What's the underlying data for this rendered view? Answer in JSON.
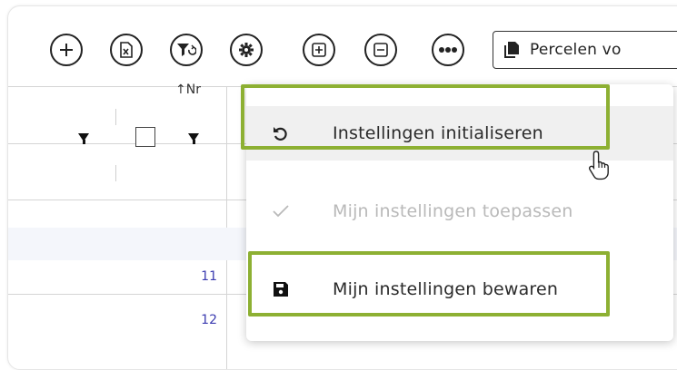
{
  "toolbar": {
    "buttons": [
      {
        "name": "add-button",
        "icon": "plus-icon"
      },
      {
        "name": "export-excel-button",
        "icon": "excel-icon"
      },
      {
        "name": "reset-filter-button",
        "icon": "filter-reset-icon"
      },
      {
        "name": "settings-button",
        "icon": "gear-icon"
      },
      {
        "name": "expand-all-button",
        "icon": "plus-square-icon"
      },
      {
        "name": "collapse-all-button",
        "icon": "minus-square-icon"
      },
      {
        "name": "more-button",
        "icon": "ellipsis-icon"
      }
    ],
    "percelen_label": "Percelen vo"
  },
  "grid": {
    "nr_header": "↑Nr",
    "rows": [
      {
        "nr": "11"
      },
      {
        "nr": "12"
      }
    ]
  },
  "menu": {
    "items": [
      {
        "label": "Instellingen initialiseren",
        "icon": "undo-icon",
        "disabled": false
      },
      {
        "label": "Mijn instellingen toepassen",
        "icon": "check-icon",
        "disabled": true
      },
      {
        "label": "Mijn instellingen bewaren",
        "icon": "save-icon",
        "disabled": false
      }
    ]
  },
  "colors": {
    "highlight": "#8db033",
    "link_number": "#3b3bb0",
    "disabled_text": "#b9b9b9"
  }
}
